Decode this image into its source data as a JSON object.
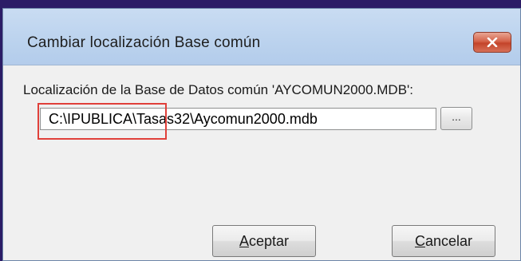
{
  "window": {
    "title": "Cambiar localización Base común",
    "close_icon": "close-icon"
  },
  "form": {
    "location_label": "Localización de la Base de Datos común 'AYCOMUN2000.MDB':",
    "path_value": "C:\\IPUBLICA\\Tasas32\\Aycomun2000.mdb",
    "browse_label": "..."
  },
  "buttons": {
    "accept": {
      "mnemonic": "A",
      "rest": "ceptar"
    },
    "cancel": {
      "mnemonic": "C",
      "rest": "ancelar"
    }
  },
  "colors": {
    "highlight": "#e0403a",
    "close_button": "#c4442a"
  }
}
